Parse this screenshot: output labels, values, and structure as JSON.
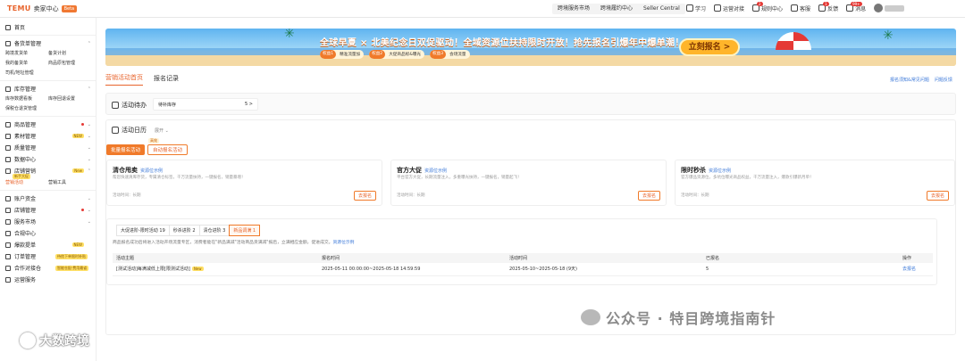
{
  "header": {
    "brand": "TEMU",
    "subtitle": "卖家中心",
    "beta": "Beta",
    "nav": [
      "跨境服务市场",
      "跨境履约中心",
      "Seller Central"
    ],
    "icons": [
      {
        "label": "学习",
        "icon": "book-icon"
      },
      {
        "label": "运营对接",
        "icon": "chat-icon"
      },
      {
        "label": "规则中心",
        "icon": "rules-icon",
        "badge": "2"
      },
      {
        "label": "客服",
        "icon": "headset-icon"
      },
      {
        "label": "反馈",
        "icon": "feedback-icon",
        "badge": "1"
      },
      {
        "label": "消息",
        "icon": "bell-icon",
        "badge": "99+"
      }
    ]
  },
  "sidebar": {
    "home": "首页",
    "prep": "备货单管理",
    "prep_sub": [
      "跨境发货单",
      "备货计划",
      "我的备货单",
      "商品原包管理",
      "司机/地址管理"
    ],
    "inventory": "库存管理",
    "inventory_sub": [
      "库存数据看板",
      "库存回退设置",
      "保税仓退货管理"
    ],
    "items": [
      {
        "label": "商品管理",
        "dot": true
      },
      {
        "label": "素材管理",
        "tag": "NEW"
      },
      {
        "label": "质量管理"
      },
      {
        "label": "数据中心"
      },
      {
        "label": "店铺营销",
        "tag": "New"
      }
    ],
    "marketing_sub": [
      "营销活动",
      "营销工具"
    ],
    "marketing_hot": "新手大促",
    "items2": [
      {
        "label": "账户资金"
      },
      {
        "label": "店铺管理",
        "dot": true
      },
      {
        "label": "服务市场"
      },
      {
        "label": "合规中心"
      },
      {
        "label": "爆款提单",
        "tag": "NEW"
      },
      {
        "label": "订单管理",
        "tag_long": "待揽下单限时补贴"
      },
      {
        "label": "合作对接仓",
        "tag_long": "智能仓配·费用最省"
      },
      {
        "label": "运营服务"
      }
    ]
  },
  "banner": {
    "title": "全球早夏 × 北美纪念日双促驱动！全域资源位扶持限时开放！抢先报名引爆年中爆单潮！",
    "pills": [
      {
        "n": "权益1",
        "t": "精准流量加"
      },
      {
        "n": "权益2",
        "t": "大促商品标&曝光"
      },
      {
        "n": "权益3",
        "t": "会场流量"
      }
    ],
    "cta": "立刻报名 >"
  },
  "tabs": [
    "营销活动首页",
    "报名记录"
  ],
  "help_links": [
    "报名须知&常见问题",
    "问题反馈"
  ],
  "todo": {
    "label": "活动待办",
    "box_label": "待补库存",
    "box_value": "5 >"
  },
  "calendar": {
    "label": "活动日历",
    "expand": "展开 ⌄",
    "btn_primary": "批量报名活动",
    "btn_secondary": "自动报名活动",
    "hot": "高效"
  },
  "activities": [
    {
      "name": "清仓甩卖",
      "rule": "资源位示例",
      "desc": "帮您快速清库存货，专属清仓标签，千万流量扶持，一键报名，销量暴增！",
      "time": "活动时间：长期",
      "btn": "去报名"
    },
    {
      "name": "官方大促",
      "rule": "资源位示例",
      "desc": "平台官方大促，长期流量注入，多重曝光扶持，一键报名，销量起飞！",
      "time": "活动时间：长期",
      "btn": "去报名"
    },
    {
      "name": "限时秒杀",
      "rule": "资源位示例",
      "desc": "官方爆品资源位，多坑位曝光商品权益，千万流量注入，爆款引爆新月单！",
      "time": "活动时间：长期",
      "btn": "去报名"
    }
  ],
  "subtabs": [
    "大促进阶-限时活动 19",
    "秒杀进阶 2",
    "清仓进阶 3",
    "新品调满 1"
  ],
  "note": "商品报名成功后将进入活动开场流量专区，消费者能在\"新品满减\"活动商品货满减\"报后，立满相应金额，促进成交。",
  "note_link": "资源位示例",
  "table": {
    "headers": [
      "活动主题",
      "报名时间",
      "活动时间",
      "已报名",
      "操作"
    ],
    "rows": [
      {
        "theme": "[测试活动]每满减低上限[限测试活动]",
        "tag": "New",
        "signup": "2025-05-11 00:00:00~2025-05-18 14:59:59",
        "period": "2025-05-10~2025-05-18 (9天)",
        "count": "5",
        "action": "去报名"
      }
    ]
  },
  "watermark": "公众号 · 特目跨境指南针",
  "watermark2": "大数跨境"
}
